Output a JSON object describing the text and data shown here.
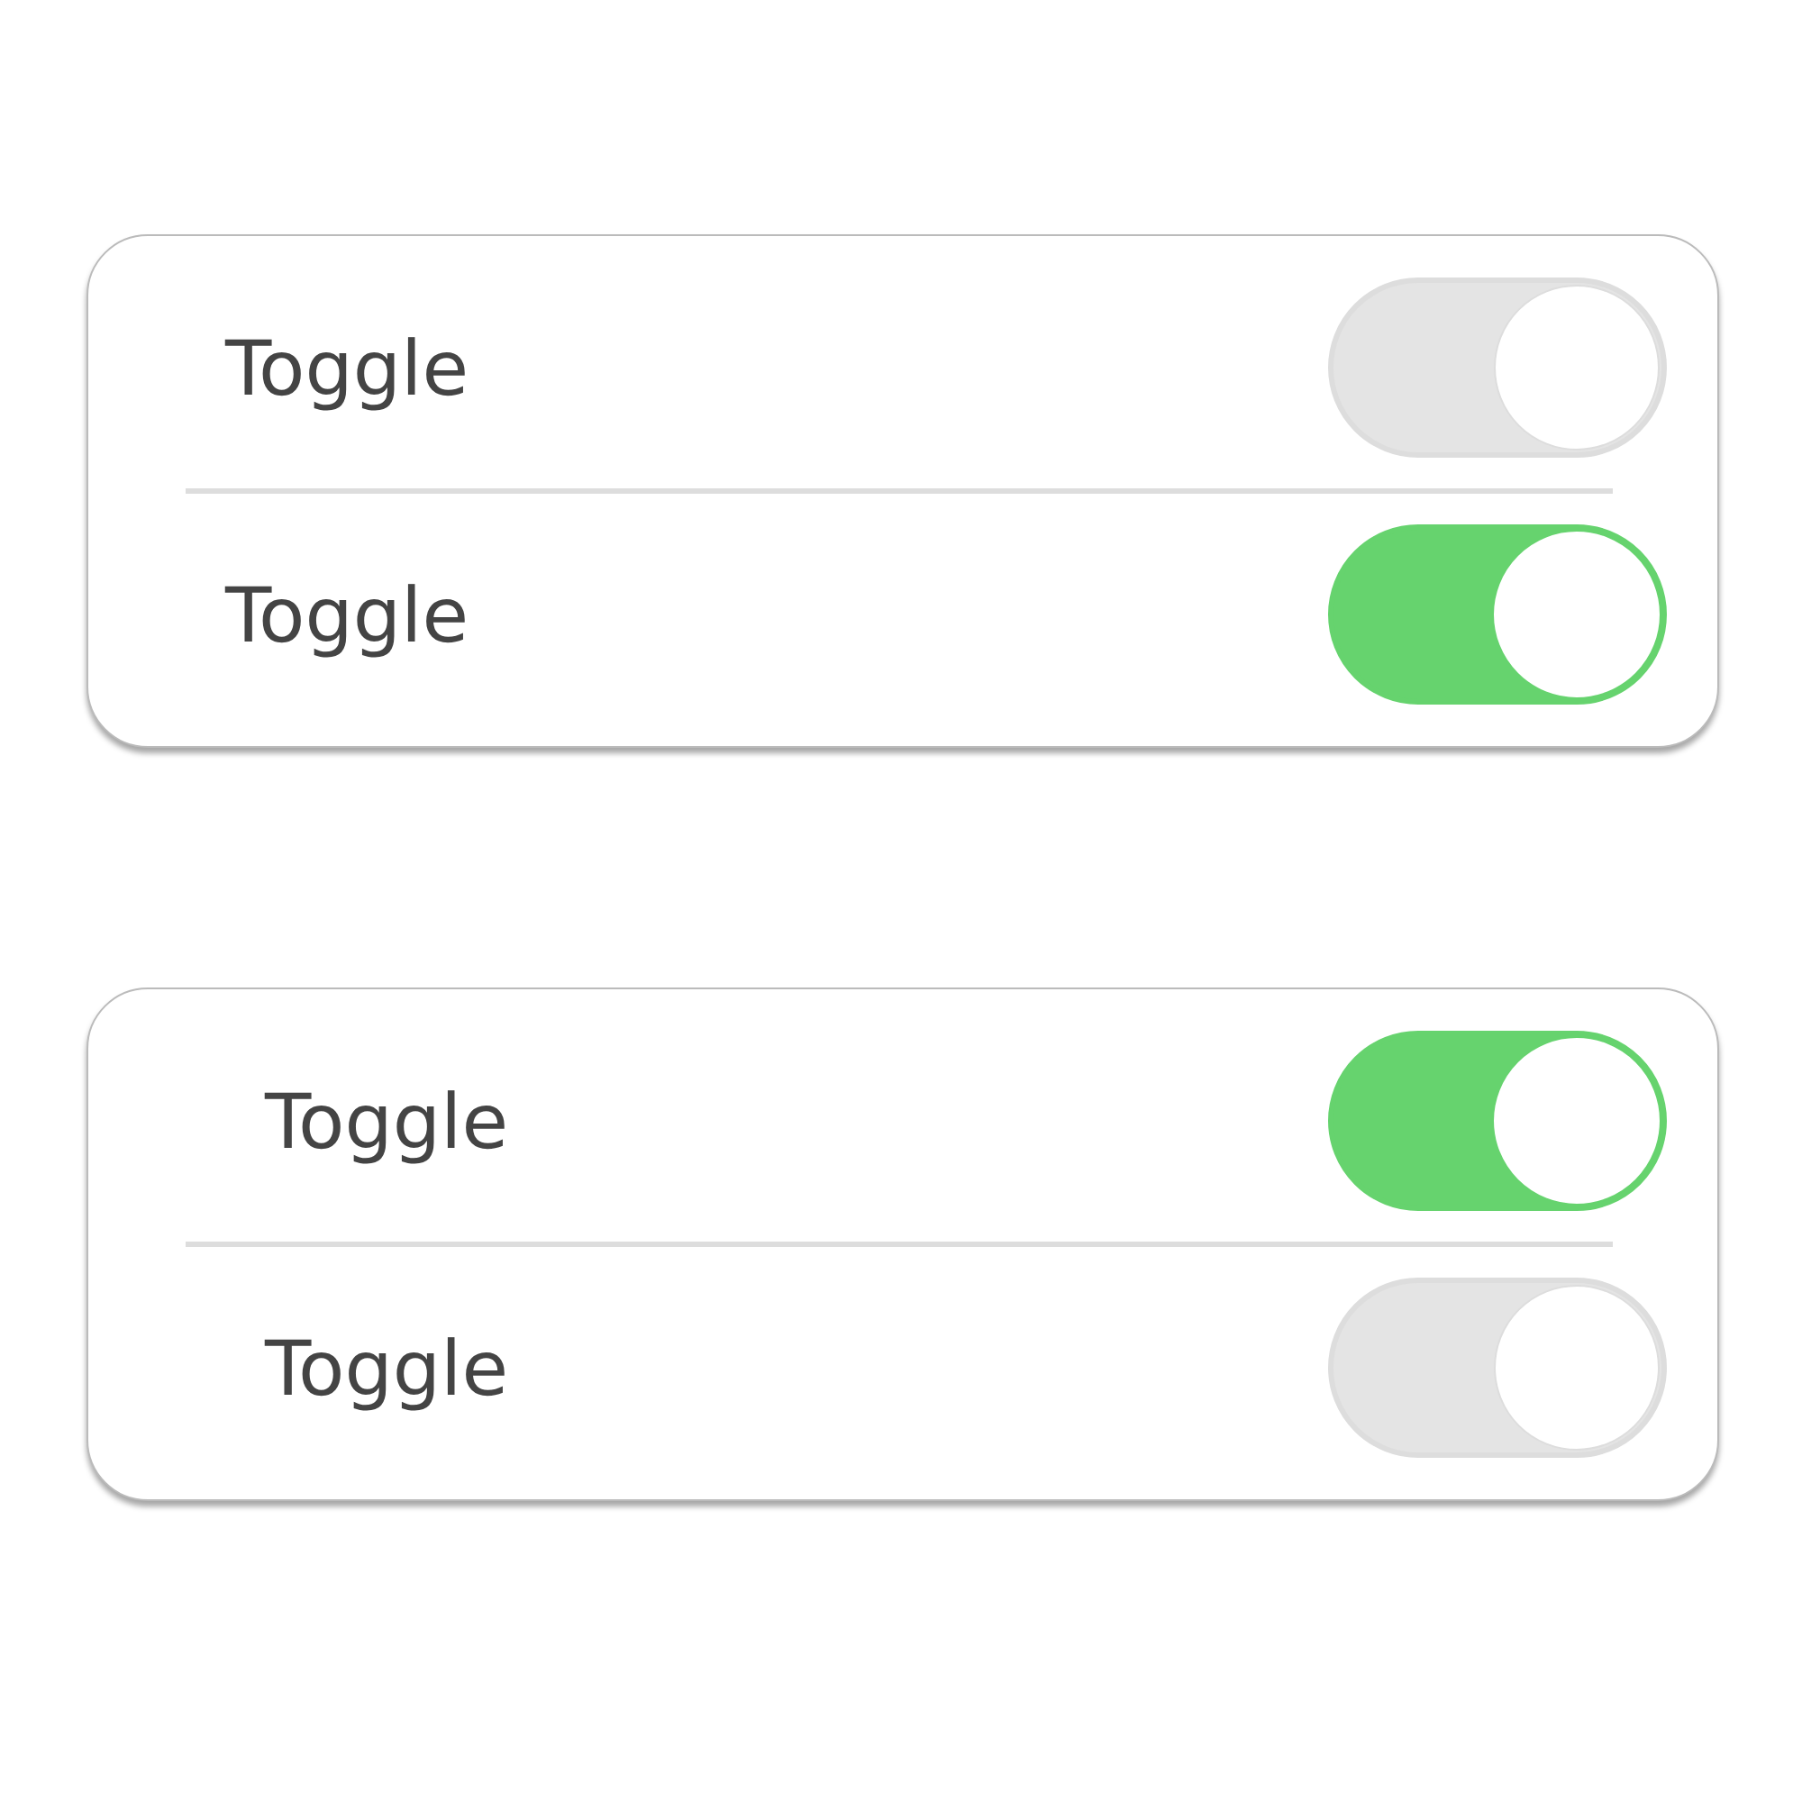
{
  "cards": [
    {
      "rows": [
        {
          "label": "Toggle",
          "on": false
        },
        {
          "label": "Toggle",
          "on": true
        }
      ]
    },
    {
      "rows": [
        {
          "label": "Toggle",
          "on": true
        },
        {
          "label": "Toggle",
          "on": false
        }
      ]
    }
  ]
}
